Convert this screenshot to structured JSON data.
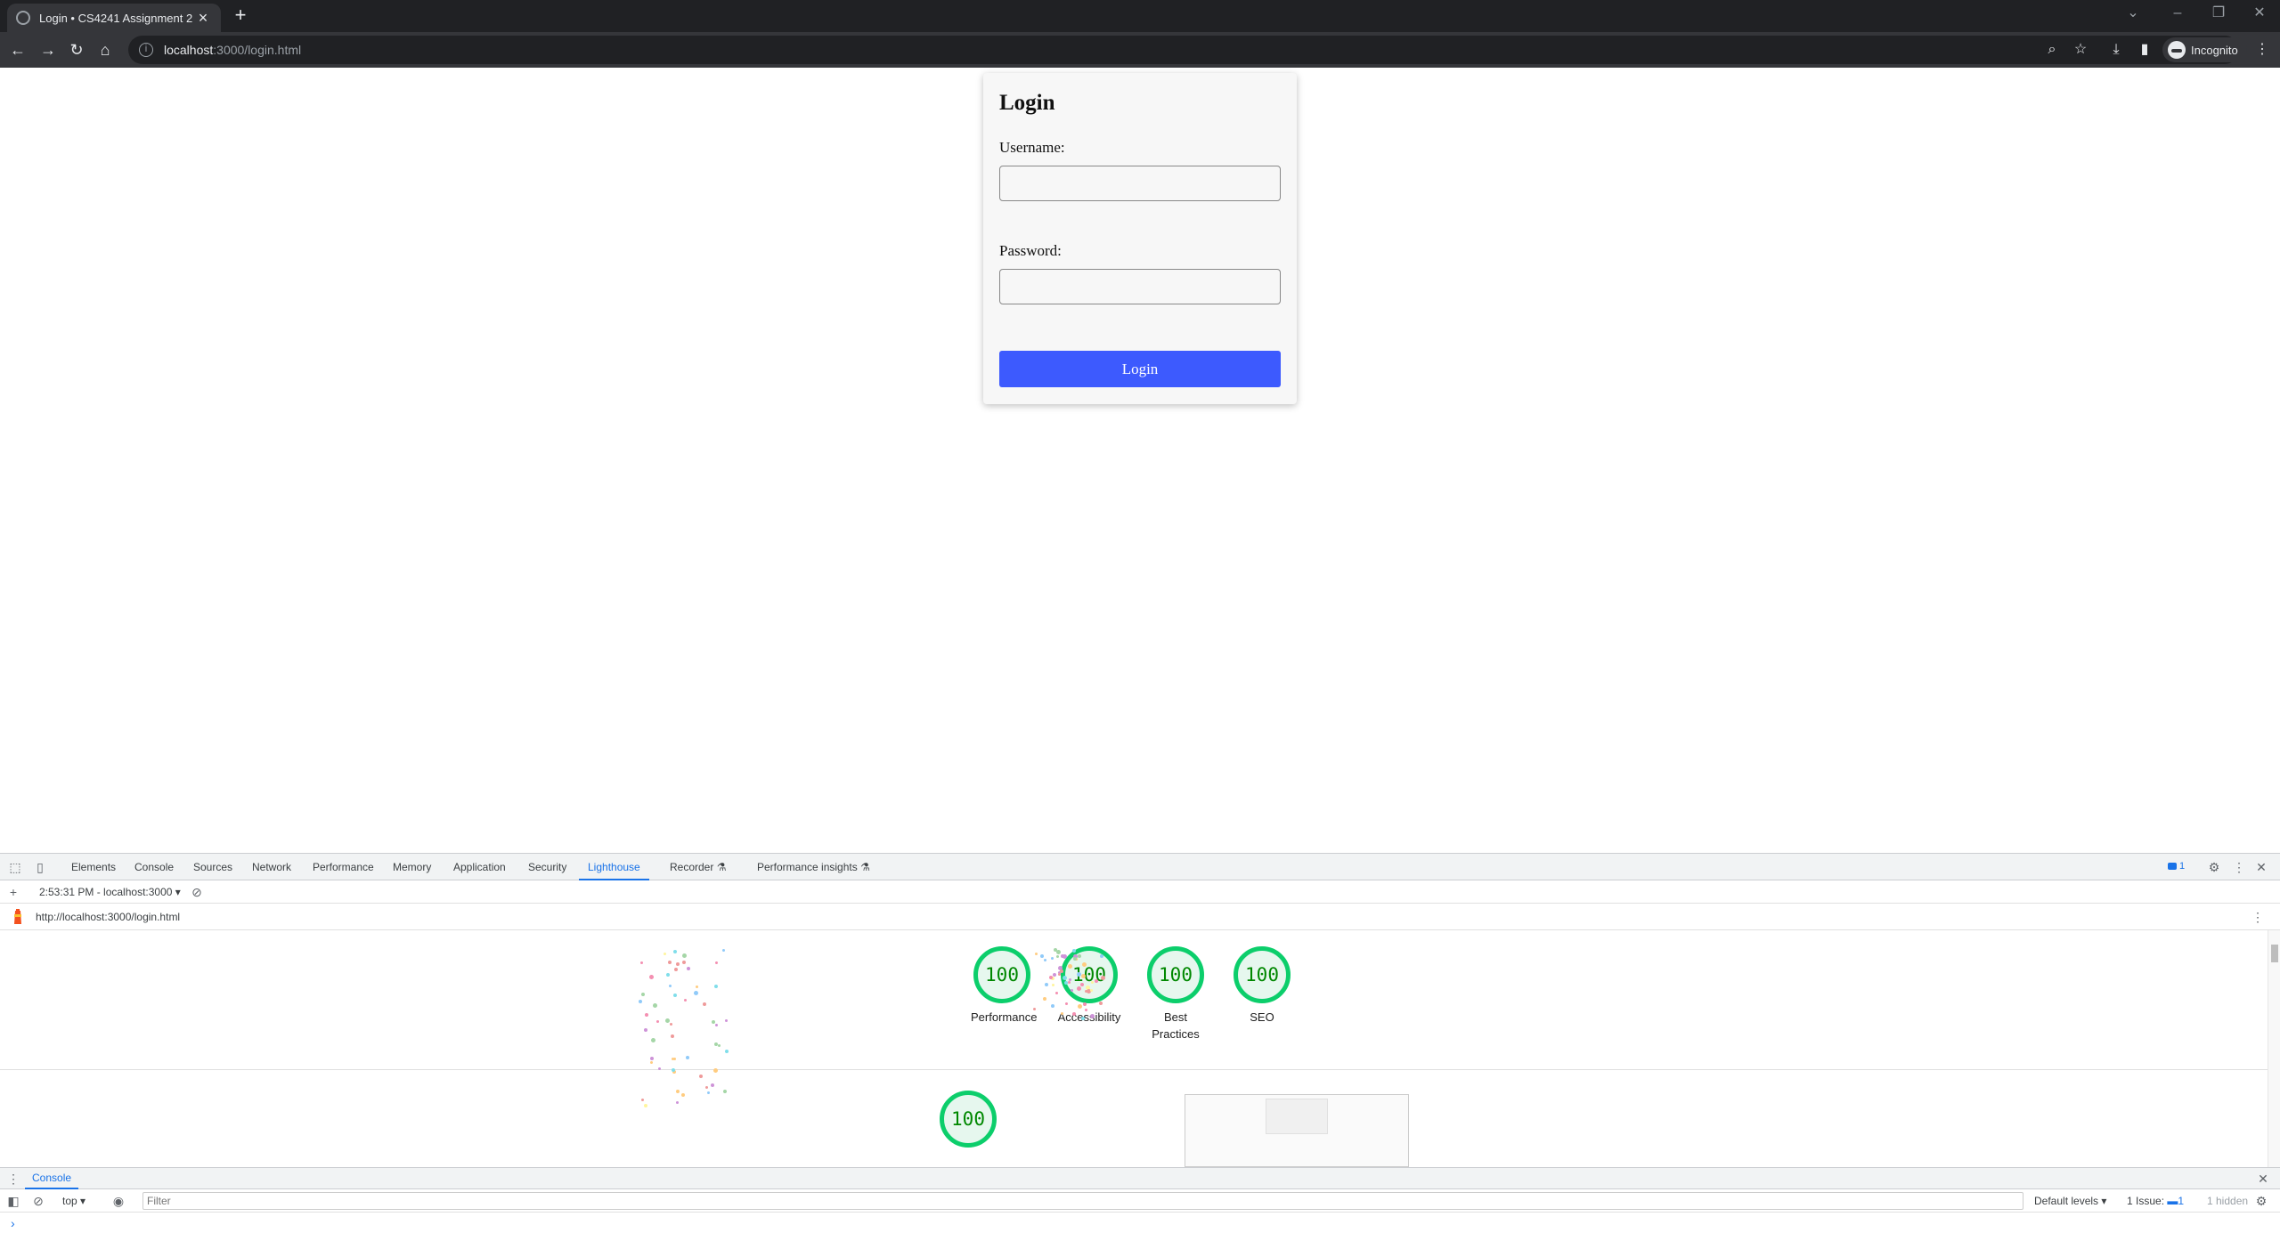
{
  "browser": {
    "tab_title": "Login • CS4241 Assignment 2",
    "url_host": "localhost",
    "url_rest": ":3000/login.html",
    "profile_label": "Incognito"
  },
  "page": {
    "heading": "Login",
    "username_label": "Username:",
    "password_label": "Password:",
    "login_button": "Login"
  },
  "devtools": {
    "tabs": [
      "Elements",
      "Console",
      "Sources",
      "Network",
      "Performance",
      "Memory",
      "Application",
      "Security",
      "Lighthouse",
      "Recorder",
      "Performance insights"
    ],
    "active_tab": "Lighthouse",
    "issues_count": "1",
    "report_selector": "2:53:31 PM - localhost:3000",
    "report_url": "http://localhost:3000/login.html",
    "scores": [
      {
        "value": "100",
        "label": "Performance"
      },
      {
        "value": "100",
        "label": "Accessibility"
      },
      {
        "value": "100",
        "label": "Best Practices"
      },
      {
        "value": "100",
        "label": "SEO"
      }
    ],
    "main_score": "100",
    "score_color": "#0cce6b",
    "drawer_tab": "Console",
    "context": "top",
    "filter_placeholder": "Filter",
    "levels": "Default levels",
    "issues_label": "1 Issue:",
    "issues_badge": "1",
    "hidden_label": "1 hidden"
  }
}
